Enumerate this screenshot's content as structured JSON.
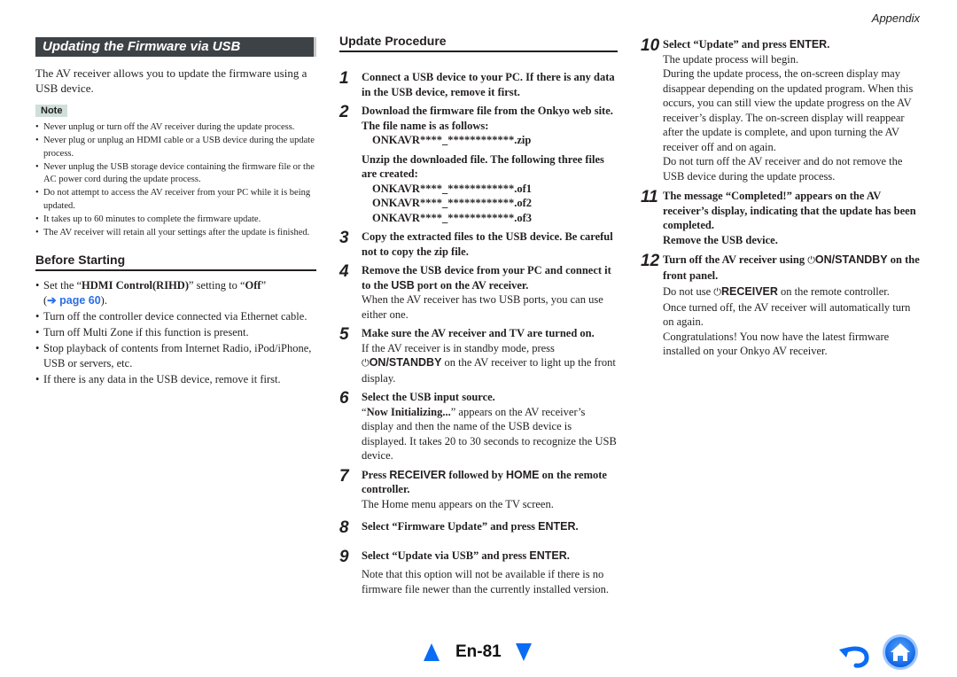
{
  "header": {
    "section": "Appendix"
  },
  "left": {
    "section_title": "Updating the Firmware via USB",
    "intro": "The AV receiver allows you to update the firmware using a USB device.",
    "note_label": "Note",
    "notes": [
      "Never unplug or turn off the AV receiver during the update process.",
      "Never plug or unplug an HDMI cable or a USB device during the update process.",
      "Never unplug the USB storage device containing the firmware file or the AC power cord during the update process.",
      "Do not attempt to access the AV receiver from your PC while it is being updated.",
      "It takes up to 60 minutes to complete the firmware update.",
      "The AV receiver will retain all your settings after the update is finished."
    ],
    "before_heading": "Before Starting",
    "before": {
      "item0_pre": "Set the “",
      "item0_bold1": "HDMI Control(RIHD)",
      "item0_mid": "” setting to “",
      "item0_bold2": "Off",
      "item0_post": "”",
      "item0_link_open": "(",
      "item0_link": "➔ page 60",
      "item0_link_close": ").",
      "items": [
        "Turn off the controller device connected via Ethernet cable.",
        "Turn off Multi Zone if this function is present.",
        "Stop playback of contents from Internet Radio, iPod/iPhone, USB or servers, etc.",
        "If there is any data in the USB device, remove it first."
      ]
    }
  },
  "procedure": {
    "heading": "Update Procedure",
    "steps": {
      "s1": {
        "num": "1",
        "title": "Connect a USB device to your PC. If there is any data in the USB device, remove it first."
      },
      "s2": {
        "num": "2",
        "title": "Download the firmware file from the Onkyo web site. The file name is as follows:",
        "zip": "ONKAVR****_************.zip",
        "unzip": "Unzip the downloaded file. The following three files are created:",
        "files": [
          "ONKAVR****_************.of1",
          "ONKAVR****_************.of2",
          "ONKAVR****_************.of3"
        ]
      },
      "s3": {
        "num": "3",
        "title": "Copy the extracted files to the USB device. Be careful not to copy the zip file."
      },
      "s4": {
        "num": "4",
        "title_pre": "Remove the USB device from your PC and connect it to the ",
        "title_key": "USB",
        "title_post": " port on the AV receiver.",
        "body": "When the AV receiver has two USB ports, you can use either one."
      },
      "s5": {
        "num": "5",
        "title": "Make sure the AV receiver and TV are turned on.",
        "body_pre": "If the AV receiver is in standby mode, press ",
        "power_glyph": "⏻",
        "body_key": "ON/STANDBY",
        "body_post": " on the AV receiver to light up the front display."
      },
      "s6": {
        "num": "6",
        "title": "Select the USB input source.",
        "body_open": "“",
        "body_bold": "Now Initializing...",
        "body_rest": "” appears on the AV receiver’s display and then the name of the USB device is displayed. It takes 20 to 30 seconds to recognize the USB device."
      },
      "s7": {
        "num": "7",
        "t1": "Press ",
        "k1": "RECEIVER",
        "t2": " followed by ",
        "k2": "HOME",
        "t3": " on the remote controller.",
        "body": "The Home menu appears on the TV screen."
      },
      "s8": {
        "num": "8",
        "title_pre": "Select “Firmware Update” and press ",
        "title_key": "ENTER",
        "title_post": "."
      },
      "s9": {
        "num": "9",
        "title_pre": "Select “Update via USB” and press ",
        "title_key": "ENTER",
        "title_post": ".",
        "body": "Note that this option will not be available if there is no firmware file newer than the currently installed version."
      },
      "s10": {
        "num": "10",
        "title_pre": "Select “Update” and press ",
        "title_key": "ENTER",
        "title_post": ".",
        "body1": "The update process will begin.",
        "body2": "During the update process, the on-screen display may disappear depending on the updated program. When this occurs, you can still view the update progress on the AV receiver’s display. The on-screen display will reappear after the update is complete, and upon turning the AV receiver off and on again.",
        "body3": "Do not turn off the AV receiver and do not remove the USB device during the update process."
      },
      "s11": {
        "num": "11",
        "title": "The message “Completed!” appears on the AV receiver’s display, indicating that the update has been completed.",
        "title2": "Remove the USB device."
      },
      "s12": {
        "num": "12",
        "title_pre": "Turn off the AV receiver using ",
        "power_glyph": "⏻",
        "title_key": "ON/STANDBY",
        "title_post": " on the front panel.",
        "body1_pre": "Do not use ",
        "body1_key": "RECEIVER",
        "body1_post": " on the remote controller.",
        "body2": "Once turned off, the AV receiver will automatically turn on again.",
        "body3": "Congratulations! You now have the latest firmware installed on your Onkyo AV receiver."
      }
    }
  },
  "footer": {
    "page_label": "En-81",
    "prev_icon": "triangle-up",
    "next_icon": "triangle-down",
    "back_icon": "return-arrow",
    "home_icon": "home",
    "accent_color": "#0a6cf5"
  }
}
